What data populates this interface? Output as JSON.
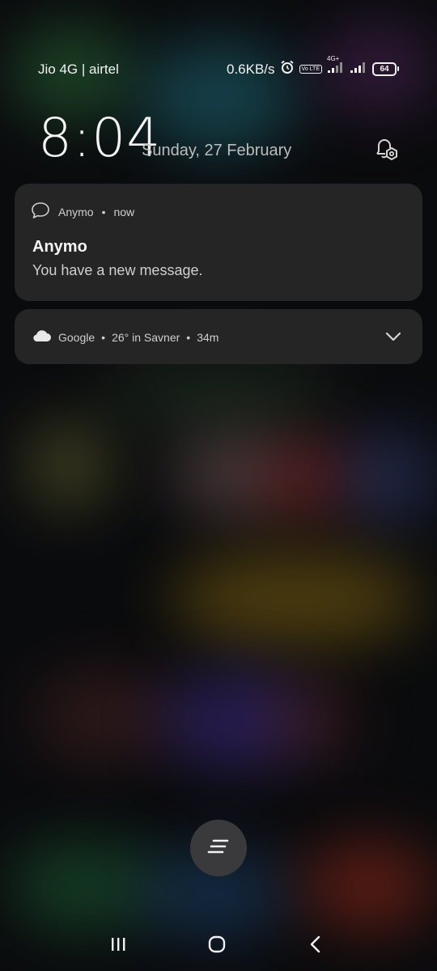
{
  "status_bar": {
    "carrier": "Jio 4G | airtel",
    "net_speed": "0.6KB/s",
    "network_type": "4G+",
    "volte_label": "Vo LTE",
    "battery": "64",
    "icons": [
      "alarm-icon",
      "volte-icon",
      "signal-icon",
      "signal-icon",
      "battery-icon"
    ]
  },
  "lockscreen": {
    "time": "8:04",
    "date": "Sunday, 27 February"
  },
  "notifications": [
    {
      "icon": "chat-bubble-icon",
      "app": "Anymo",
      "when": "now",
      "title": "Anymo",
      "body": "You have a new message."
    },
    {
      "icon": "cloud-icon",
      "app": "Google",
      "summary": "26° in Savner",
      "when": "34m"
    }
  ],
  "nav": {
    "items": [
      "recents-icon",
      "home-icon",
      "back-icon"
    ]
  }
}
